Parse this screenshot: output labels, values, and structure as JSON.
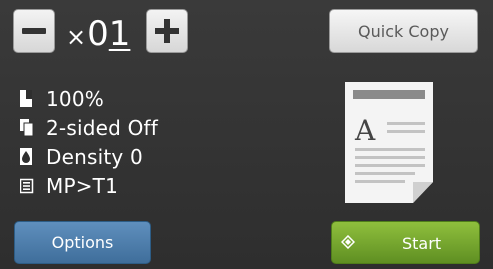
{
  "toolbar": {
    "copies_prefix": "×",
    "copies_digit_1": "0",
    "copies_digit_2": "1",
    "quick_copy_label": "Quick Copy"
  },
  "settings": [
    {
      "label": "100%",
      "icon": "enlarge-icon"
    },
    {
      "label": "2-sided Off",
      "icon": "two-sided-icon"
    },
    {
      "label": "Density 0",
      "icon": "density-drop-icon"
    },
    {
      "label": "MP>T1",
      "icon": "tray-list-icon"
    }
  ],
  "preview": {
    "letter": "A",
    "icon": "document-preview-icon"
  },
  "bottom": {
    "options_label": "Options",
    "start_label": "Start",
    "start_icon": "start-diamond-icon"
  },
  "colors": {
    "background": "#333333",
    "options": "#4f7fae",
    "start": "#7aab2f",
    "light_button": "#e6e6e6"
  }
}
